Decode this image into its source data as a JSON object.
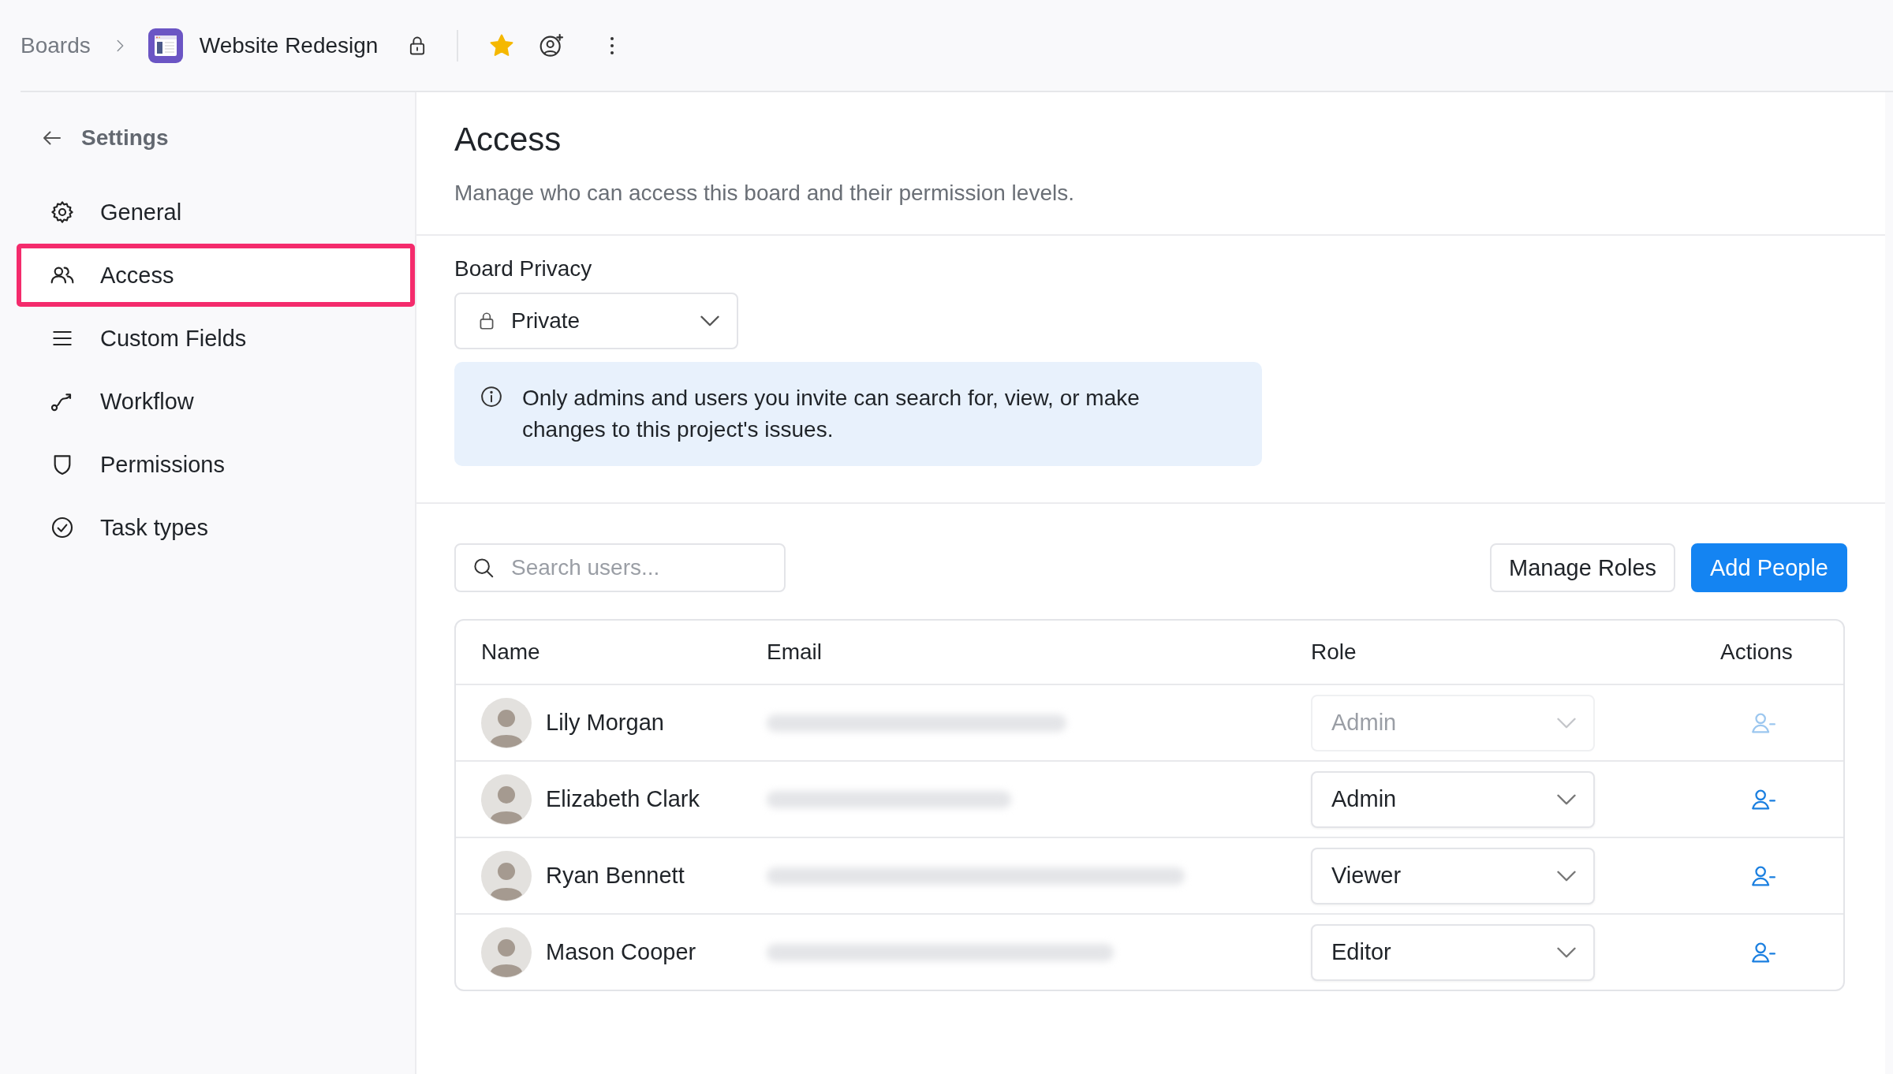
{
  "breadcrumb": {
    "parent": "Boards",
    "board": "Website Redesign",
    "starred": true
  },
  "sidebar": {
    "back_label": "Settings",
    "items": [
      {
        "label": "General",
        "selected": false
      },
      {
        "label": "Access",
        "selected": true
      },
      {
        "label": "Custom Fields",
        "selected": false
      },
      {
        "label": "Workflow",
        "selected": false
      },
      {
        "label": "Permissions",
        "selected": false
      },
      {
        "label": "Task types",
        "selected": false
      }
    ]
  },
  "page": {
    "title": "Access",
    "description": "Manage who can access this board and their permission levels."
  },
  "privacy": {
    "label": "Board Privacy",
    "value": "Private",
    "notice": "Only admins and users you invite can search for, view, or make changes to this project's issues."
  },
  "search": {
    "placeholder": "Search users..."
  },
  "buttons": [
    {
      "label": "Manage Roles",
      "kind": "secondary"
    },
    {
      "label": "Add People",
      "kind": "primary"
    }
  ],
  "table": {
    "columns": [
      "Name",
      "Email",
      "Role",
      "Actions"
    ],
    "rows": [
      {
        "name": "Lily Morgan",
        "role": "Admin",
        "disabled": true
      },
      {
        "name": "Elizabeth Clark",
        "role": "Admin",
        "disabled": false
      },
      {
        "name": "Ryan Bennett",
        "role": "Viewer",
        "disabled": false
      },
      {
        "name": "Mason Cooper",
        "role": "Editor",
        "disabled": false
      }
    ]
  }
}
